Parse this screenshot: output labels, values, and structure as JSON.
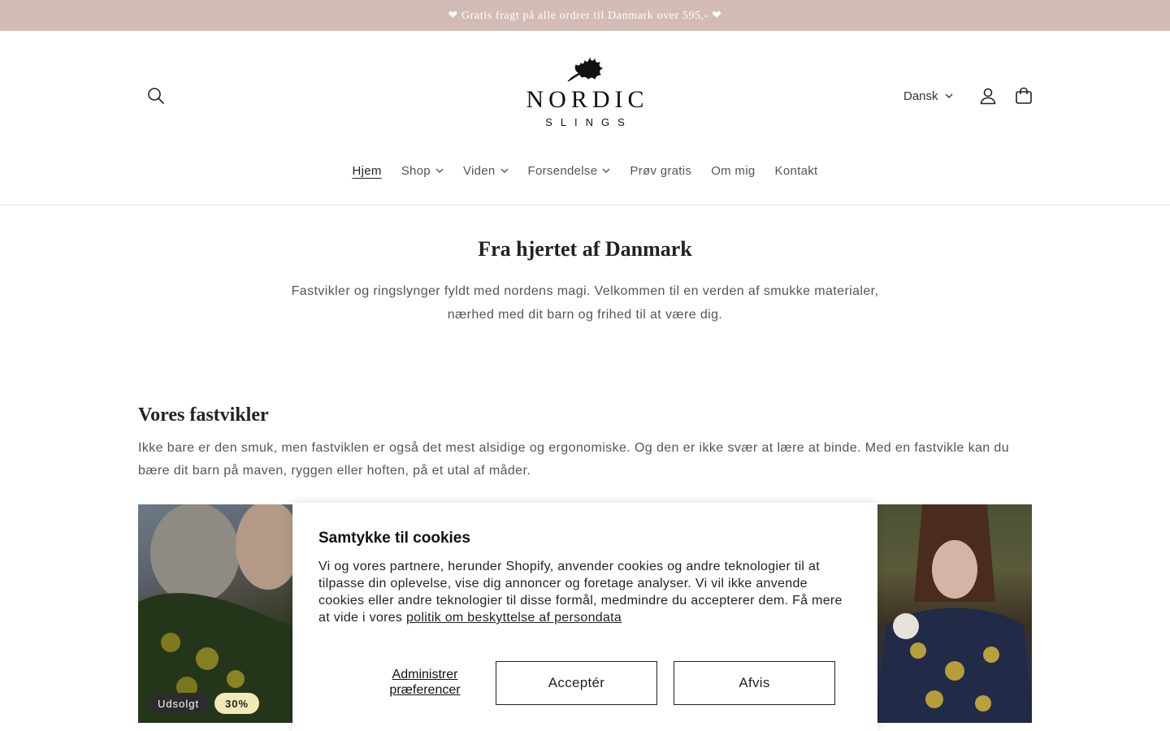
{
  "announcement": "❤ Gratis fragt på alle ordrer til Danmark over 595,- ❤",
  "header": {
    "logo_title": "NORDIC",
    "logo_subtitle": "SLINGS",
    "language": "Dansk"
  },
  "nav": [
    {
      "label": "Hjem",
      "dropdown": false
    },
    {
      "label": "Shop",
      "dropdown": true
    },
    {
      "label": "Viden",
      "dropdown": true
    },
    {
      "label": "Forsendelse",
      "dropdown": true
    },
    {
      "label": "Prøv gratis",
      "dropdown": false
    },
    {
      "label": "Om mig",
      "dropdown": false
    },
    {
      "label": "Kontakt",
      "dropdown": false
    }
  ],
  "hero": {
    "title": "Fra hjertet af Danmark",
    "text": "Fastvikler og ringslynger fyldt med nordens magi. Velkommen til en verden af smukke materialer, nærhed med dit barn og frihed til at være dig."
  },
  "section": {
    "title": "Vores fastvikler",
    "text": "Ikke bare er den smuk, men fastviklen er også det mest alsidige og ergonomiske. Og den er ikke svær at lære at binde. Med en fastvikle kan du bære dit barn på maven, ryggen eller hoften, på et utal af måder."
  },
  "product_badges": {
    "sold_out": "Udsolgt",
    "discount": "30%"
  },
  "cookie": {
    "title": "Samtykke til cookies",
    "text": "Vi og vores partnere, herunder Shopify, anvender cookies og andre teknologier til at tilpasse din oplevelse, vise dig annoncer og foretage analyser. Vi vil ikke anvende cookies eller andre teknologier til disse formål, medmindre du accepterer dem. Få mere at vide i vores ",
    "link_text": "politik om beskyttelse af persondata",
    "manage_label": "Administrer præferencer",
    "accept_label": "Acceptér",
    "reject_label": "Afvis"
  }
}
